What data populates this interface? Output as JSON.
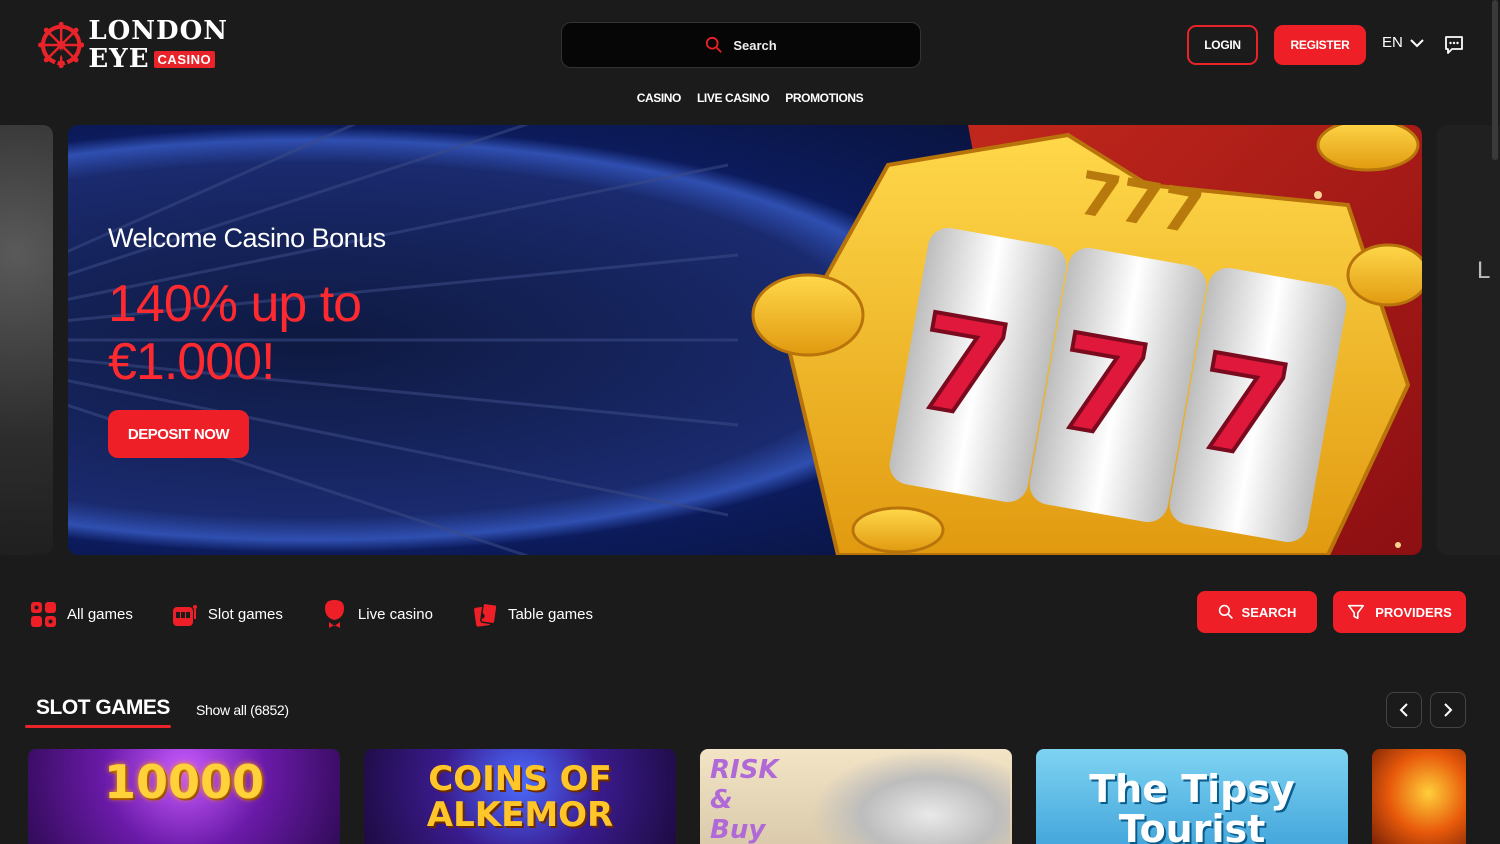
{
  "header": {
    "logo": {
      "line1": "LONDON",
      "line2": "EYE",
      "badge": "CASINO"
    },
    "search_label": "Search",
    "login_label": "LOGIN",
    "register_label": "REGISTER",
    "language": "EN"
  },
  "nav": {
    "items": [
      {
        "label": "CASINO"
      },
      {
        "label": "LIVE CASINO"
      },
      {
        "label": "PROMOTIONS"
      }
    ]
  },
  "hero": {
    "title": "Welcome Casino Bonus",
    "amount": "140% up to €1.000!",
    "cta_label": "DEPOSIT NOW",
    "next_peek_text": "L"
  },
  "categories": {
    "items": [
      {
        "label": "All games",
        "icon": "grid-icon"
      },
      {
        "label": "Slot games",
        "icon": "slot-machine-icon"
      },
      {
        "label": "Live casino",
        "icon": "dealer-icon"
      },
      {
        "label": "Table games",
        "icon": "cards-icon"
      }
    ],
    "search_label": "SEARCH",
    "providers_label": "PROVIDERS"
  },
  "slot_section": {
    "title": "SLOT GAMES",
    "show_all": "Show all (6852)",
    "games": [
      {
        "title": "10000"
      },
      {
        "title": "COINS OF ALKEMOR"
      },
      {
        "title": "RISK & Buy"
      },
      {
        "title": "The Tipsy Tourist"
      },
      {
        "title": ""
      }
    ]
  },
  "colors": {
    "accent": "#ee1f26",
    "background": "#1b1b1b"
  }
}
